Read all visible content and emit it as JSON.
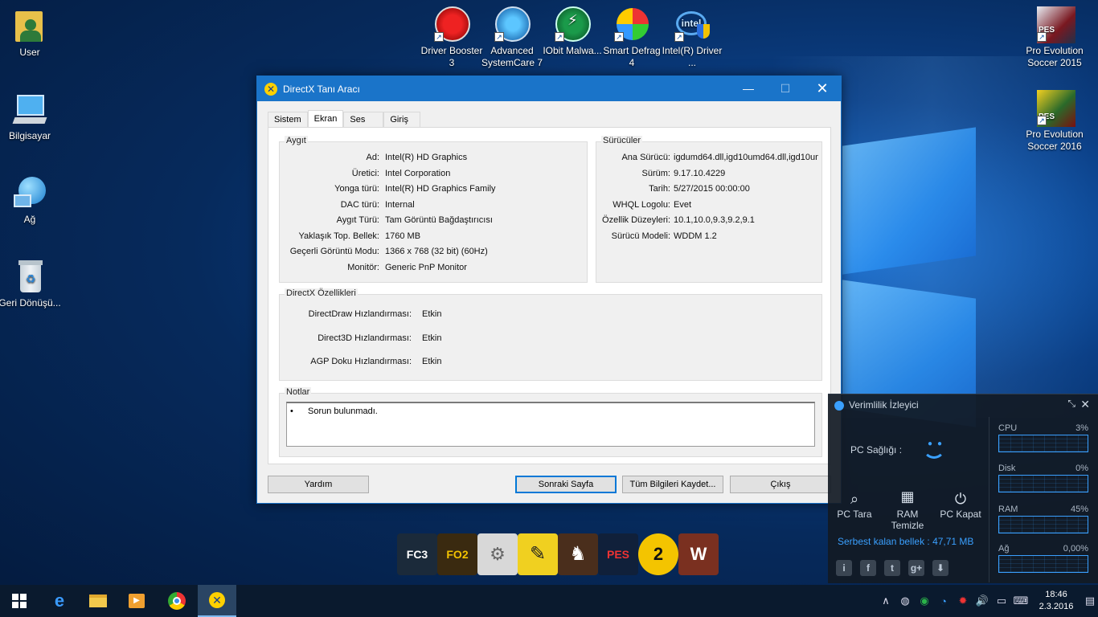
{
  "desktop_left": [
    {
      "label": "User"
    },
    {
      "label": "Bilgisayar"
    },
    {
      "label": "Ağ"
    },
    {
      "label": "Geri Dönüşü..."
    }
  ],
  "desktop_top": [
    {
      "label": "Driver Booster 3"
    },
    {
      "label": "Advanced SystemCare 7"
    },
    {
      "label": "IObit Malwa..."
    },
    {
      "label": "Smart Defrag 4"
    },
    {
      "label": "Intel(R) Driver ..."
    }
  ],
  "desktop_right": [
    {
      "label": "Pro Evolution Soccer 2015"
    },
    {
      "label": "Pro Evolution Soccer 2016"
    }
  ],
  "dialog": {
    "title": "DirectX Tanı Aracı",
    "min_glyph": "—",
    "max_glyph": "☐",
    "close_glyph": "✕",
    "tabs": [
      "Sistem",
      "Ekran",
      "Ses",
      "Giriş"
    ],
    "device": {
      "title": "Aygıt",
      "rows": [
        {
          "label": "Ad:",
          "value": "Intel(R) HD Graphics"
        },
        {
          "label": "Üretici:",
          "value": "Intel Corporation"
        },
        {
          "label": "Yonga türü:",
          "value": "Intel(R) HD Graphics Family"
        },
        {
          "label": "DAC türü:",
          "value": "Internal"
        },
        {
          "label": "Aygıt Türü:",
          "value": "Tam Görüntü Bağdaştırıcısı"
        },
        {
          "label": "Yaklaşık Top. Bellek:",
          "value": "1760 MB"
        },
        {
          "label": "Geçerli Görüntü Modu:",
          "value": "1366 x 768 (32 bit) (60Hz)"
        },
        {
          "label": "Monitör:",
          "value": "Generic PnP Monitor"
        }
      ]
    },
    "drivers": {
      "title": "Sürücüler",
      "rows": [
        {
          "label": "Ana Sürücü:",
          "value": "igdumd64.dll,igd10umd64.dll,igd10um"
        },
        {
          "label": "Sürüm:",
          "value": "9.17.10.4229"
        },
        {
          "label": "Tarih:",
          "value": "5/27/2015 00:00:00"
        },
        {
          "label": "WHQL Logolu:",
          "value": "Evet"
        },
        {
          "label": "Özellik Düzeyleri:",
          "value": "10.1,10.0,9.3,9.2,9.1"
        },
        {
          "label": "Sürücü Modeli:",
          "value": "WDDM 1.2"
        }
      ]
    },
    "features": {
      "title": "DirectX Özellikleri",
      "rows": [
        {
          "label": "DirectDraw Hızlandırması:",
          "value": "Etkin"
        },
        {
          "label": "Direct3D Hızlandırması:",
          "value": "Etkin"
        },
        {
          "label": "AGP Doku Hızlandırması:",
          "value": "Etkin"
        }
      ]
    },
    "notes": {
      "title": "Notlar",
      "bullet": "•",
      "text": "Sorun bulunmadı."
    },
    "buttons": {
      "help": "Yardım",
      "next": "Sonraki Sayfa",
      "save": "Tüm Bilgileri Kaydet...",
      "exit": "Çıkış"
    }
  },
  "perf": {
    "title": "Verimlilik İzleyici",
    "health_label": "PC Sağlığı :",
    "actions": [
      {
        "label": "PC Tara",
        "icon": "search-icon"
      },
      {
        "label": "RAM Temizle",
        "icon": "ram-icon"
      },
      {
        "label": "PC Kapat",
        "icon": "power-icon"
      }
    ],
    "free_memory": "Serbest kalan bellek : 47,71 MB",
    "metrics": [
      {
        "name": "CPU",
        "value": "3%",
        "level": 0.03
      },
      {
        "name": "Disk",
        "value": "0%",
        "level": 0.0
      },
      {
        "name": "RAM",
        "value": "45%",
        "level": 0.45
      },
      {
        "name": "Ağ",
        "value": "0,00%",
        "level": 0.0
      }
    ]
  },
  "gamebar": {
    "items": [
      {
        "label": "FC3",
        "icon": "farcry3-icon",
        "color": "#1b2a3a"
      },
      {
        "label": "FO2",
        "icon": "flatout2-icon",
        "color": "#3a2a10"
      },
      {
        "label": "",
        "icon": "settings-icon",
        "color": "#d8d8d8"
      },
      {
        "label": "",
        "icon": "pencil-icon",
        "color": "#f0d020"
      },
      {
        "label": "",
        "icon": "horse-icon",
        "color": "#4a2e1c"
      },
      {
        "label": "PES",
        "icon": "pes-icon",
        "color": "#10203a"
      },
      {
        "label": "2",
        "icon": "number-two-icon",
        "color": "#f4c400"
      },
      {
        "label": "W",
        "icon": "w-game-icon",
        "color": "#7a3020"
      }
    ]
  },
  "taskbar": {
    "clock_time": "18:46",
    "clock_date": "2.3.2016"
  }
}
